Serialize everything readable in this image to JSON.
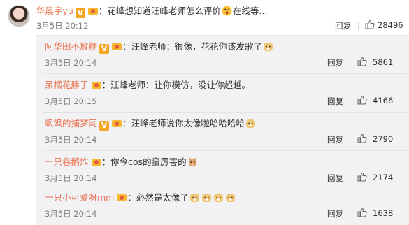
{
  "main_comment": {
    "author": "华晨宇yu",
    "separator": "：",
    "text": "花峰想知道汪峰老师怎么评价",
    "text_after_emoji": "在线等...",
    "emoji": "surprised-face",
    "time": "3月5日 20:12",
    "reply_label": "回复",
    "likes": "28496"
  },
  "replies": [
    {
      "author": "阿华田不放糖",
      "separator": "：",
      "text": "汪峰老师：很像，花花你该发歌了",
      "emojis": [
        "doge-icon"
      ],
      "time": "3月5日 20:14",
      "reply_label": "回复",
      "likes": "5861"
    },
    {
      "author": "呆橘花胖子",
      "separator": "：",
      "text": "汪峰老师：让你模仿，没让你超越。",
      "emojis": [],
      "time": "3月5日 20:15",
      "reply_label": "回复",
      "likes": "4166"
    },
    {
      "author": "飒飒的捕梦网",
      "separator": "：",
      "text": "汪峰老师说你太像啦哈哈哈哈",
      "emojis": [
        "doge-icon"
      ],
      "time": "3月5日 20:14",
      "reply_label": "回复",
      "likes": "2790"
    },
    {
      "author": "一只卷鹅炸",
      "separator": "：",
      "text": "你今cos的蛮厉害的",
      "emojis": [
        "cat-icon"
      ],
      "time": "3月5日 20:14",
      "reply_label": "回复",
      "likes": "2174"
    },
    {
      "author": "一只小可爱呀mm",
      "separator": "：",
      "text": "必然是太像了",
      "emojis": [
        "doge-icon",
        "doge-icon",
        "doge-icon",
        "doge-icon"
      ],
      "time": "3月5日 20:14",
      "reply_label": "回复",
      "likes": "1638"
    }
  ],
  "colors": {
    "author": "#eb7350",
    "vip_badge": "#f5a623",
    "reply_bg": "#f2f2f5"
  }
}
